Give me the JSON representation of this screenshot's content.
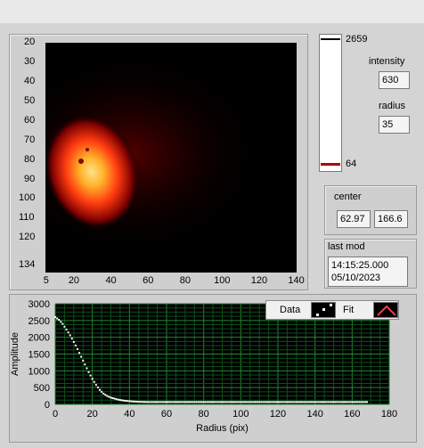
{
  "image": {
    "y_ticks": [
      "20",
      "30",
      "40",
      "50",
      "60",
      "70",
      "80",
      "90",
      "100",
      "110",
      "120",
      "134"
    ],
    "x_ticks": [
      "5",
      "20",
      "40",
      "60",
      "80",
      "100",
      "120",
      "140"
    ]
  },
  "colorbar": {
    "max": "2659",
    "min": "64"
  },
  "intensity": {
    "label": "intensity",
    "value": "630"
  },
  "radius": {
    "label": "radius",
    "value": "35"
  },
  "center": {
    "label": "center",
    "x": "62.97",
    "y": "166.6"
  },
  "last_mod": {
    "label": "last mod",
    "time": "14:15:25.000",
    "date": "05/10/2023"
  },
  "chart_data": {
    "type": "scatter",
    "xlabel": "Radius (pix)",
    "ylabel": "Amplitude",
    "xlim": [
      0,
      180
    ],
    "ylim": [
      0,
      3000
    ],
    "x_ticks": [
      "0",
      "20",
      "40",
      "60",
      "80",
      "100",
      "120",
      "140",
      "160",
      "180"
    ],
    "y_ticks": [
      "0",
      "500",
      "1000",
      "1500",
      "2000",
      "2500",
      "3000"
    ],
    "series": [
      {
        "name": "Data",
        "x": [
          0,
          2,
          4,
          6,
          8,
          10,
          12,
          14,
          16,
          18,
          20,
          22,
          24,
          26,
          28,
          30,
          32,
          34,
          36,
          38,
          40,
          42,
          44,
          46,
          48,
          50,
          60,
          70,
          80,
          90,
          100,
          110,
          120,
          130,
          140,
          150,
          160,
          168
        ],
        "values": [
          2600,
          2520,
          2400,
          2230,
          2060,
          1860,
          1650,
          1420,
          1190,
          960,
          760,
          580,
          430,
          320,
          250,
          200,
          170,
          140,
          120,
          105,
          95,
          85,
          80,
          75,
          72,
          70,
          70,
          70,
          70,
          70,
          70,
          70,
          70,
          70,
          70,
          70,
          70,
          70
        ]
      },
      {
        "name": "Fit",
        "x": [],
        "values": []
      }
    ],
    "legend": {
      "data_label": "Data",
      "fit_label": "Fit"
    }
  }
}
